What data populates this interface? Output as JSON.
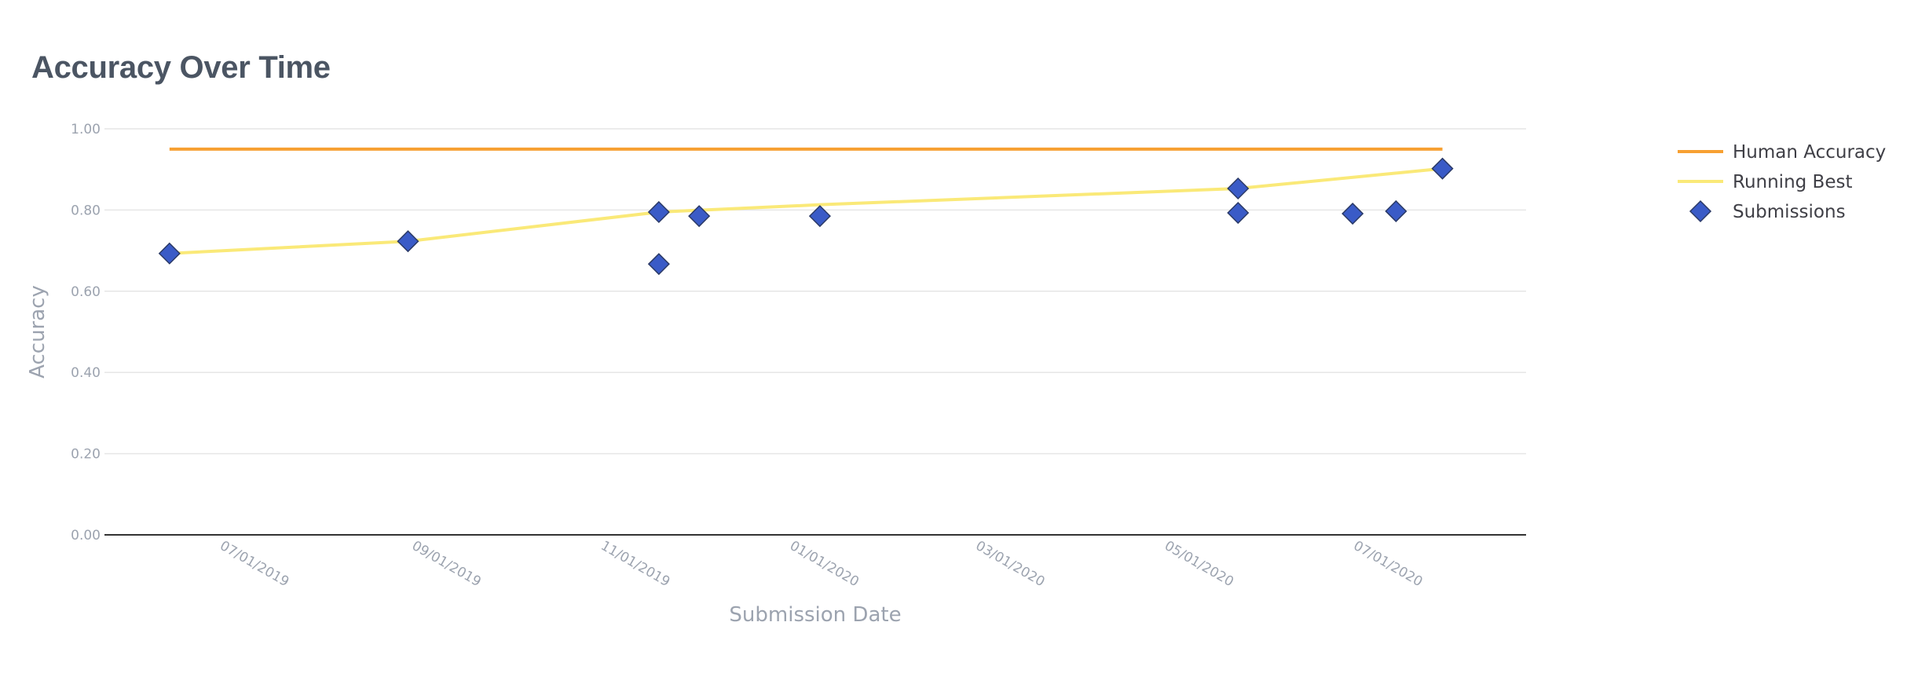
{
  "chart_data": {
    "type": "line",
    "title": "Accuracy Over Time",
    "xlabel": "Submission Date",
    "ylabel": "Accuracy",
    "ylim": [
      0,
      1
    ],
    "xlim": [
      "2019-05-25",
      "2020-08-26"
    ],
    "y_ticks": [
      0,
      0.2,
      0.4,
      0.6,
      0.8,
      1.0
    ],
    "y_tick_labels": [
      "0.00",
      "0.20",
      "0.40",
      "0.60",
      "0.80",
      "1.00"
    ],
    "x_ticks": [
      "2019-07-01",
      "2019-09-01",
      "2019-11-01",
      "2020-01-01",
      "2020-03-01",
      "2020-05-01",
      "2020-07-01"
    ],
    "x_tick_labels": [
      "07/01/2019",
      "09/01/2019",
      "11/01/2019",
      "01/01/2020",
      "03/01/2020",
      "05/01/2020",
      "07/01/2020"
    ],
    "grid": true,
    "legend_position": "top-right",
    "series": [
      {
        "name": "Human Accuracy",
        "kind": "line",
        "color": "#f7a032",
        "x": [
          "2019-06-15",
          "2020-07-30"
        ],
        "y": [
          0.95,
          0.95
        ]
      },
      {
        "name": "Running Best",
        "kind": "line",
        "color": "#fae978",
        "x": [
          "2019-06-15",
          "2019-08-31",
          "2019-11-20",
          "2020-01-11",
          "2020-05-25",
          "2020-07-30"
        ],
        "y": [
          0.693,
          0.723,
          0.795,
          0.813,
          0.853,
          0.902
        ]
      },
      {
        "name": "Submissions",
        "kind": "scatter",
        "marker": "diamond",
        "color": "#3a5bc7",
        "x": [
          "2019-06-15",
          "2019-08-31",
          "2019-11-20",
          "2019-11-20",
          "2019-12-03",
          "2020-01-11",
          "2020-05-25",
          "2020-05-25",
          "2020-07-01",
          "2020-07-15",
          "2020-07-30"
        ],
        "y": [
          0.693,
          0.723,
          0.795,
          0.667,
          0.785,
          0.785,
          0.853,
          0.793,
          0.791,
          0.797,
          0.902
        ]
      }
    ]
  }
}
